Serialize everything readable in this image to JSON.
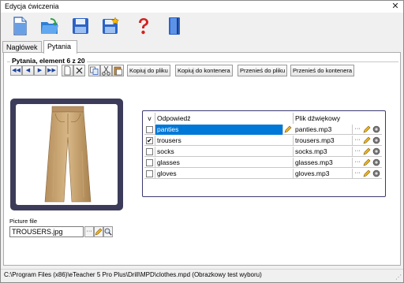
{
  "window": {
    "title": "Edycja ćwiczenia",
    "close_glyph": "✕"
  },
  "toolbar": {
    "icons": [
      "new-document-icon",
      "open-folder-icon",
      "save-icon",
      "save-as-icon",
      "help-icon",
      "book-icon"
    ]
  },
  "tabs": [
    {
      "label": "Nagłówek",
      "active": false
    },
    {
      "label": "Pytania",
      "active": true
    }
  ],
  "questions": {
    "group_label": "Pytania, element 6 z 20",
    "nav_glyphs": [
      "◀◀",
      "◀",
      "▶",
      "▶▶"
    ],
    "buttons": {
      "copy_to_file": "Kopiuj do pliku",
      "copy_to_container": "Kopiuj do kontenera",
      "move_to_file": "Przenieś do pliku",
      "move_to_container": "Przenieś do kontenera"
    }
  },
  "picture": {
    "label": "Picture file",
    "value": "TROUSERS.jpg",
    "browse_glyph": "···"
  },
  "answers": {
    "columns": {
      "check": "v",
      "answer": "Odpowiedź",
      "sound": "Plik dźwiękowy"
    },
    "rows": [
      {
        "checked": false,
        "answer": "panties",
        "sound": "panties.mp3",
        "selected": true
      },
      {
        "checked": true,
        "answer": "trousers",
        "sound": "trousers.mp3",
        "selected": false
      },
      {
        "checked": false,
        "answer": "socks",
        "sound": "socks.mp3",
        "selected": false
      },
      {
        "checked": false,
        "answer": "glasses",
        "sound": "glasses.mp3",
        "selected": false
      },
      {
        "checked": false,
        "answer": "gloves",
        "sound": "gloves.mp3",
        "selected": false
      }
    ],
    "more_glyph": "···",
    "check_glyph": "✔"
  },
  "status": {
    "text": "C:\\Program Files (x86)\\eTeacher 5 Pro Plus\\Drill\\MPD\\clothes.mpd (Obrazkowy test wyboru)"
  },
  "colors": {
    "selection": "#0078d7",
    "frame": "#3c3c5a",
    "grid_border": "#3a3a70"
  }
}
